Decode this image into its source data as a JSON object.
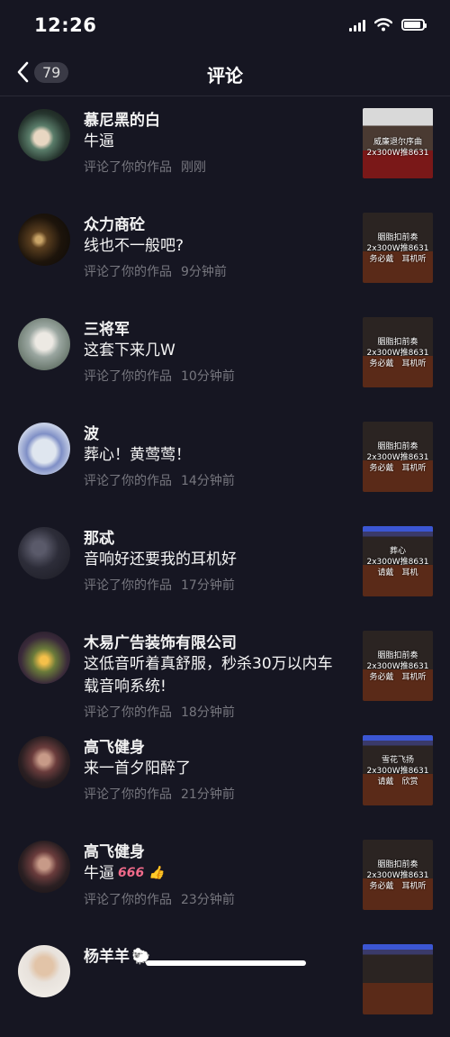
{
  "status": {
    "time": "12:26"
  },
  "nav": {
    "count": "79",
    "title": "评论"
  },
  "comments": [
    {
      "name": "慕尼黑的白",
      "text": "牛逼",
      "meta": "评论了你的作品",
      "time": "刚刚",
      "thumb": "威廉退尔序曲\n2x300W推8631"
    },
    {
      "name": "众力商砼",
      "text": "线也不一般吧?",
      "meta": "评论了你的作品",
      "time": "9分钟前",
      "thumb": "胭脂扣前奏\n2x300W推8631\n务必戴　耳机听"
    },
    {
      "name": "三将军",
      "text": "这套下来几W",
      "meta": "评论了你的作品",
      "time": "10分钟前",
      "thumb": "胭脂扣前奏\n2x300W推8631\n务必戴　耳机听"
    },
    {
      "name": "波",
      "text": "葬心！黄莺莺！",
      "meta": "评论了你的作品",
      "time": "14分钟前",
      "thumb": "胭脂扣前奏\n2x300W推8631\n务必戴　耳机听"
    },
    {
      "name": "那忒",
      "text": "音响好还要我的耳机好",
      "meta": "评论了你的作品",
      "time": "17分钟前",
      "thumb": "葬心\n2x300W推8631\n请戴　耳机"
    },
    {
      "name": "木易广告装饰有限公司",
      "text": "这低音听着真舒服，秒杀30万以内车载音响系统!",
      "meta": "评论了你的作品",
      "time": "18分钟前",
      "thumb": "胭脂扣前奏\n2x300W推8631\n务必戴　耳机听"
    },
    {
      "name": "高飞健身",
      "text": "来一首夕阳醉了",
      "meta": "评论了你的作品",
      "time": "21分钟前",
      "thumb": "雪花飞扬\n2x300W推8631\n请戴　欣赏"
    },
    {
      "name": "高飞健身",
      "text": "牛逼",
      "emoji": "666 👍",
      "meta": "评论了你的作品",
      "time": "23分钟前",
      "thumb": "胭脂扣前奏\n2x300W推8631\n务必戴　耳机听"
    },
    {
      "name": "杨羊羊",
      "emoji": "🐑",
      "text": "",
      "meta": "",
      "time": "",
      "thumb": ""
    }
  ]
}
